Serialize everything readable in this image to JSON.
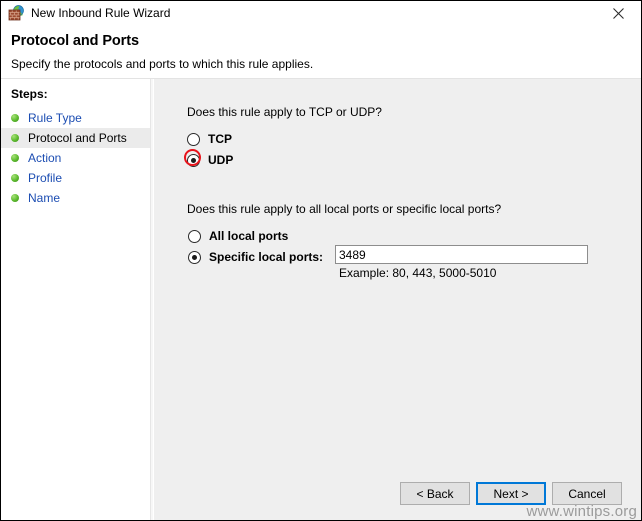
{
  "window": {
    "title": "New Inbound Rule Wizard",
    "app_icon": "firewall-icon",
    "close_icon": "close-icon"
  },
  "header": {
    "title": "Protocol and Ports",
    "subtitle": "Specify the protocols and ports to which this rule applies."
  },
  "sidebar": {
    "label": "Steps:",
    "items": [
      {
        "label": "Rule Type",
        "current": false
      },
      {
        "label": "Protocol and Ports",
        "current": true
      },
      {
        "label": "Action",
        "current": false
      },
      {
        "label": "Profile",
        "current": false
      },
      {
        "label": "Name",
        "current": false
      }
    ]
  },
  "main": {
    "protocol_question": "Does this rule apply to TCP or UDP?",
    "protocol_options": [
      {
        "label": "TCP",
        "checked": false
      },
      {
        "label": "UDP",
        "checked": true
      }
    ],
    "ports_question": "Does this rule apply to all local ports or specific local ports?",
    "ports_options": [
      {
        "label": "All local ports",
        "checked": false
      },
      {
        "label": "Specific local ports:",
        "checked": true
      }
    ],
    "ports_value": "3489",
    "ports_placeholder": "",
    "ports_example": "Example: 80, 443, 5000-5010"
  },
  "footer": {
    "back_label": "< Back",
    "next_label": "Next >",
    "cancel_label": "Cancel"
  },
  "watermark": "www.wintips.org",
  "colors": {
    "accent": "#0078d7",
    "annotation": "#e8131b",
    "link": "#1c4db2",
    "step_bullet": "#5cba2e",
    "panel": "#efefef"
  }
}
